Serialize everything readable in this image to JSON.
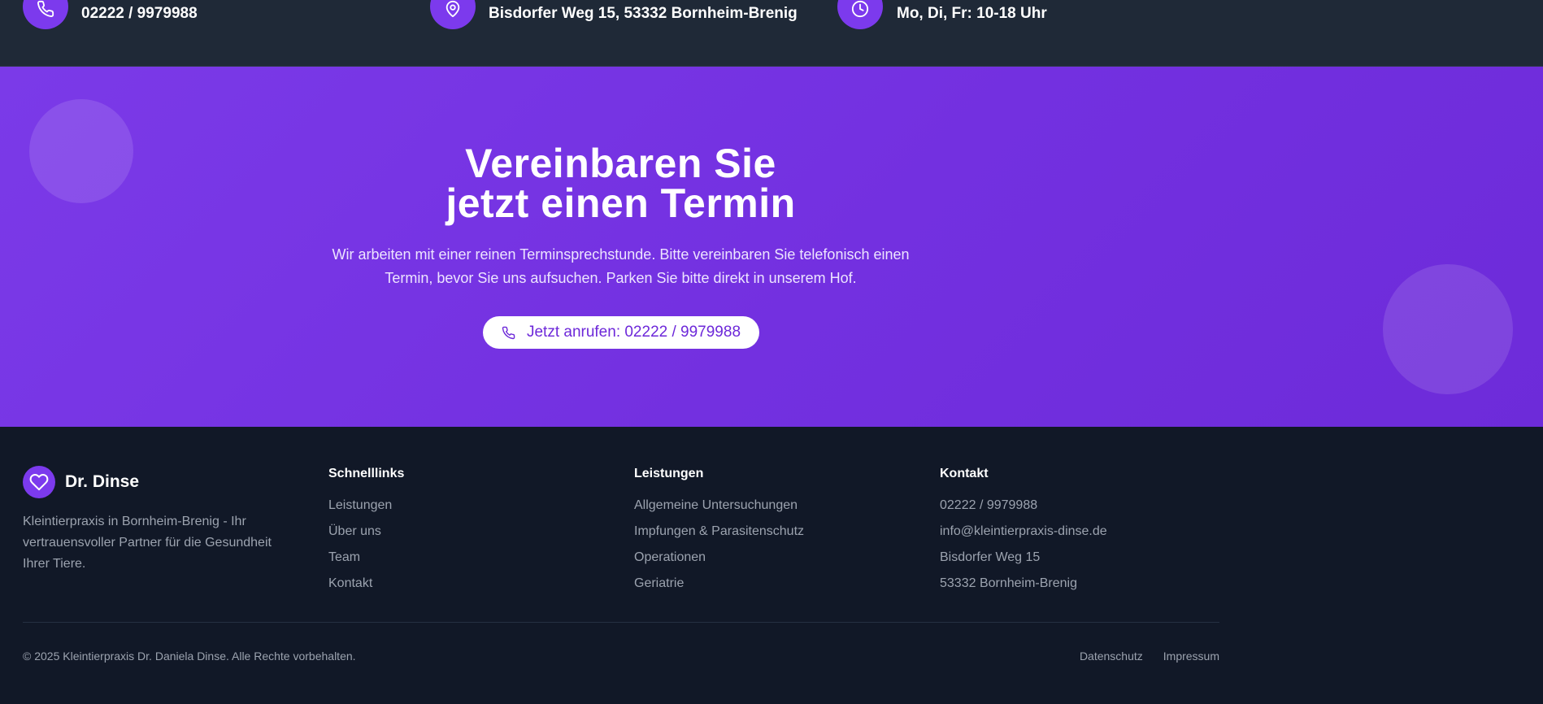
{
  "topbar": {
    "phone": "02222 / 9979988",
    "address": "Bisdorfer Weg 15, 53332 Bornheim-Brenig",
    "hours": "Mo, Di, Fr: 10-18 Uhr"
  },
  "cta": {
    "title_line1": "Vereinbaren Sie",
    "title_line2": "jetzt einen Termin",
    "desc_line1": "Wir arbeiten mit einer reinen Terminsprechstunde. Bitte vereinbaren Sie telefonisch einen",
    "desc_line2": "Termin, bevor Sie uns aufsuchen. Parken Sie bitte direkt in unserem Hof.",
    "button_label": "Jetzt anrufen: 02222 / 9979988"
  },
  "footer": {
    "brand_name": "Dr. Dinse",
    "brand_desc": "Kleintierpraxis in Bornheim-Brenig - Ihr vertrauensvoller Partner für die Gesundheit Ihrer Tiere.",
    "quicklinks": {
      "title": "Schnelllinks",
      "items": [
        "Leistungen",
        "Über uns",
        "Team",
        "Kontakt"
      ]
    },
    "services": {
      "title": "Leistungen",
      "items": [
        "Allgemeine Untersuchungen",
        "Impfungen & Parasitenschutz",
        "Operationen",
        "Geriatrie"
      ]
    },
    "contact": {
      "title": "Kontakt",
      "items": [
        "02222 / 9979988",
        "info@kleintierpraxis-dinse.de",
        "Bisdorfer Weg 15",
        "53332 Bornheim-Brenig"
      ]
    },
    "copyright": "© 2025 Kleintierpraxis Dr. Daniela Dinse. Alle Rechte vorbehalten.",
    "legal": {
      "privacy": "Datenschutz",
      "imprint": "Impressum"
    }
  },
  "colors": {
    "accent": "#7c3aed",
    "dark_bg": "#111827",
    "topbar_bg": "#1f2937"
  },
  "icons": {
    "phone": "phone-icon",
    "location": "map-pin-icon",
    "clock": "clock-icon",
    "heart": "heart-icon"
  }
}
